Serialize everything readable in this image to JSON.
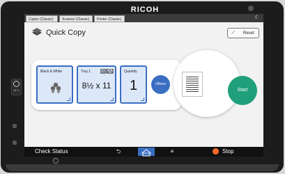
{
  "device": {
    "brand": "RICOH"
  },
  "app_tabs": [
    {
      "label": "Copier (Classic)"
    },
    {
      "label": "Scanner (Classic)"
    },
    {
      "label": "Printer (Classic)"
    }
  ],
  "header": {
    "title": "Quick Copy",
    "reset_label": "Reset"
  },
  "settings": {
    "color": {
      "label": "Black & White"
    },
    "paper": {
      "label": "Tray 1",
      "value": "8½ x 11"
    },
    "quantity": {
      "label": "Quantity",
      "value": "1"
    },
    "others_label": "Others"
  },
  "start_label": "Start",
  "taskbar": {
    "check_status": "Check Status",
    "stop_label": "Stop"
  },
  "colors": {
    "accent": "#3a6ec2",
    "start": "#1fa07a",
    "stop": "#ff6a2a"
  },
  "icons": [
    "copy-icon",
    "reset-icon",
    "color-dots-icon",
    "tray-icon",
    "back-icon",
    "home-icon",
    "menu-icon",
    "stop-icon",
    "moon-icon"
  ]
}
